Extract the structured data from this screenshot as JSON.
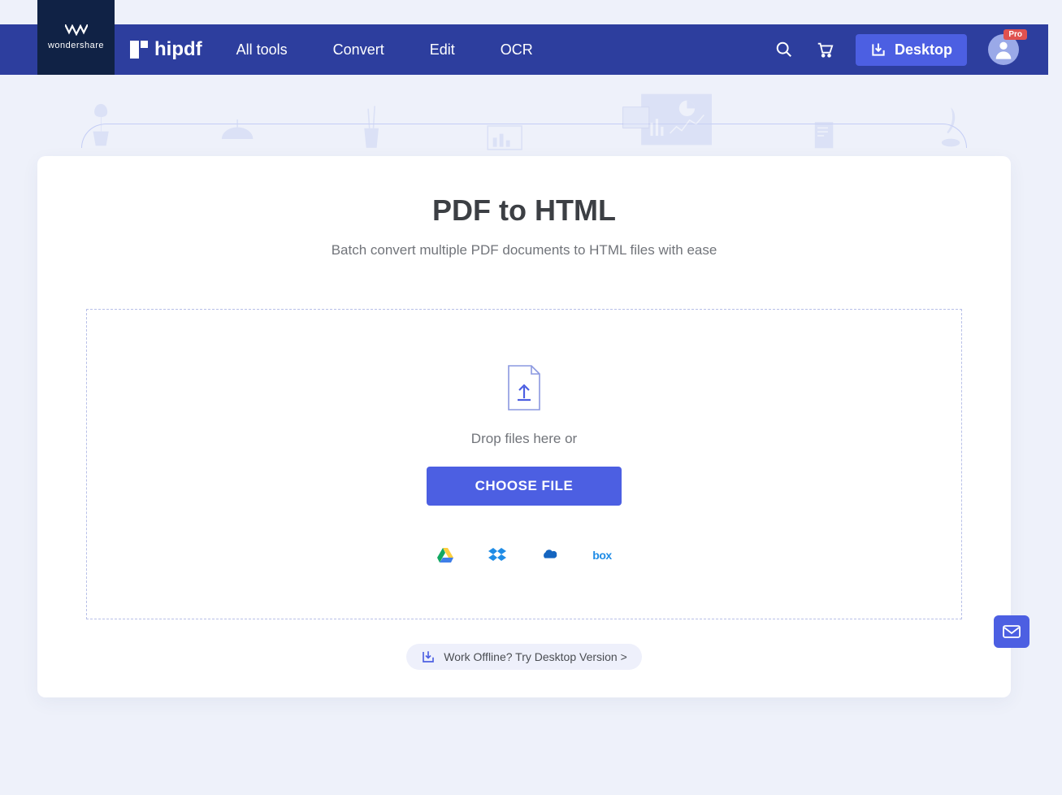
{
  "brand": {
    "name": "wondershare"
  },
  "logo": {
    "text": "hipdf"
  },
  "nav": {
    "items": [
      "All tools",
      "Convert",
      "Edit",
      "OCR"
    ],
    "desktop": "Desktop",
    "pro": "Pro"
  },
  "page": {
    "title": "PDF to HTML",
    "subtitle": "Batch convert multiple PDF documents to HTML files with ease"
  },
  "dropzone": {
    "hint": "Drop files here or",
    "button": "CHOOSE FILE"
  },
  "clouds": {
    "drive": "google-drive",
    "dropbox": "dropbox",
    "onedrive": "onedrive",
    "box": "box"
  },
  "offline": {
    "text": "Work Offline? Try Desktop Version >"
  }
}
